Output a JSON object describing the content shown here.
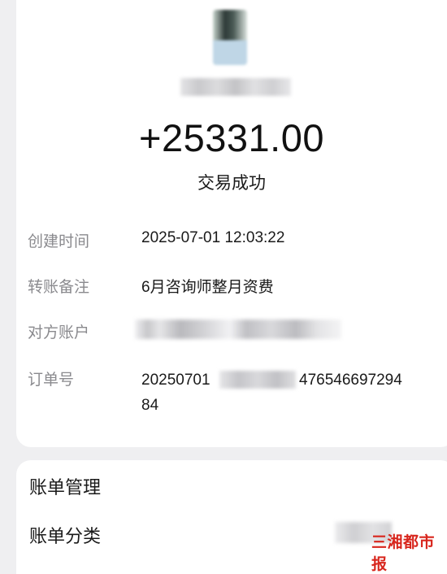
{
  "transaction": {
    "amount": "+25331.00",
    "status": "交易成功"
  },
  "details": {
    "created_label": "创建时间",
    "created_value": "2025-07-01 12:03:22",
    "memo_label": "转账备注",
    "memo_value": "6月咨询师整月资费",
    "account_label": "对方账户",
    "order_label": "订单号",
    "order_prefix": "20250701",
    "order_suffix": "476546697294",
    "order_line2": "84"
  },
  "bill": {
    "management": "账单管理",
    "category": "账单分类"
  },
  "watermark": {
    "text": "三湘都市报",
    "color": "#d8261d"
  },
  "colors": {
    "background": "#efeff1",
    "card": "#ffffff",
    "label": "#8a8a8e"
  }
}
